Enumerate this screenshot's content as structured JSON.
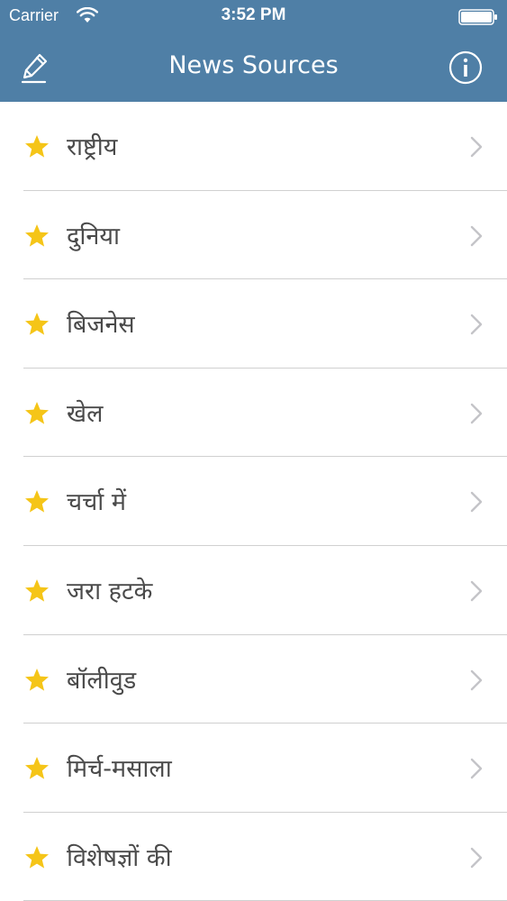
{
  "status_bar": {
    "carrier": "Carrier",
    "time": "3:52 PM"
  },
  "nav_bar": {
    "title": "News Sources",
    "left_icon": "pencil-icon",
    "right_icon": "info-icon",
    "color": "#4f7fa6"
  },
  "list": {
    "items": [
      {
        "label": "राष्ट्रीय"
      },
      {
        "label": "दुनिया"
      },
      {
        "label": "बिजनेस"
      },
      {
        "label": "खेल"
      },
      {
        "label": "चर्चा में"
      },
      {
        "label": "जरा हटके"
      },
      {
        "label": "बॉलीवुड"
      },
      {
        "label": "मिर्च-मसाला"
      },
      {
        "label": "विशेषज्ञों की"
      }
    ],
    "star_color": "#f5c518"
  }
}
